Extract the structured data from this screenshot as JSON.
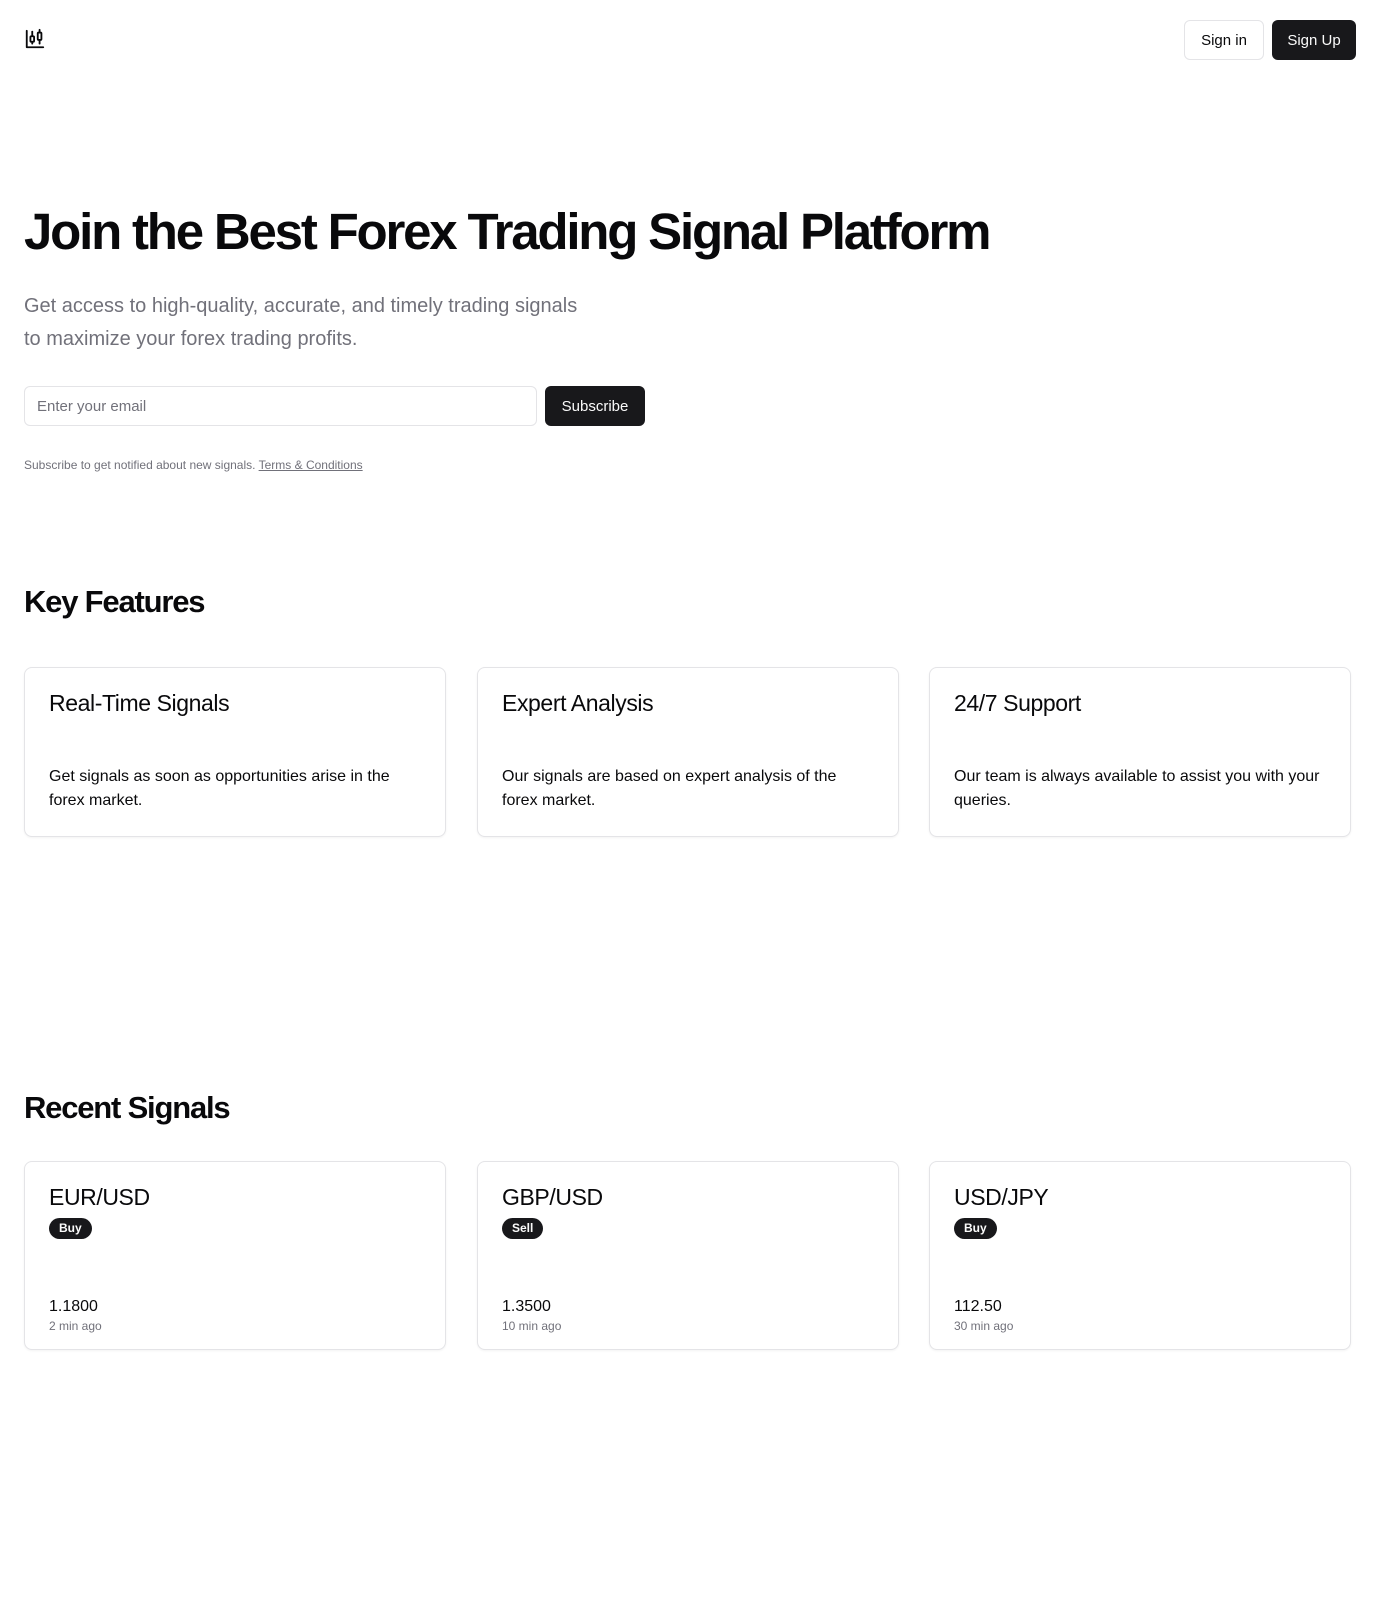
{
  "header": {
    "logo_icon": "candlestick-chart-icon",
    "signin_label": "Sign in",
    "signup_label": "Sign Up"
  },
  "hero": {
    "title": "Join the Best Forex Trading Signal Platform",
    "subtitle_line1": "Get access to high-quality, accurate, and timely trading signals",
    "subtitle_line2": "to maximize your forex trading profits.",
    "email_placeholder": "Enter your email",
    "email_value": "",
    "subscribe_label": "Subscribe",
    "fine_print": "Subscribe to get notified about new signals. ",
    "terms_link": "Terms & Conditions"
  },
  "features": {
    "title": "Key Features",
    "items": [
      {
        "title": "Real-Time Signals",
        "desc": "Get signals as soon as opportunities arise in the forex market."
      },
      {
        "title": "Expert Analysis",
        "desc": "Our signals are based on expert analysis of the forex market."
      },
      {
        "title": "24/7 Support",
        "desc": "Our team is always available to assist you with your queries."
      }
    ]
  },
  "signals": {
    "title": "Recent Signals",
    "items": [
      {
        "pair": "EUR/USD",
        "action": "Buy",
        "price": "1.1800",
        "time": "2 min ago"
      },
      {
        "pair": "GBP/USD",
        "action": "Sell",
        "price": "1.3500",
        "time": "10 min ago"
      },
      {
        "pair": "USD/JPY",
        "action": "Buy",
        "price": "112.50",
        "time": "30 min ago"
      }
    ]
  },
  "colors": {
    "primary": "#18181b",
    "muted_text": "#71717a",
    "border": "#e4e4e7"
  }
}
